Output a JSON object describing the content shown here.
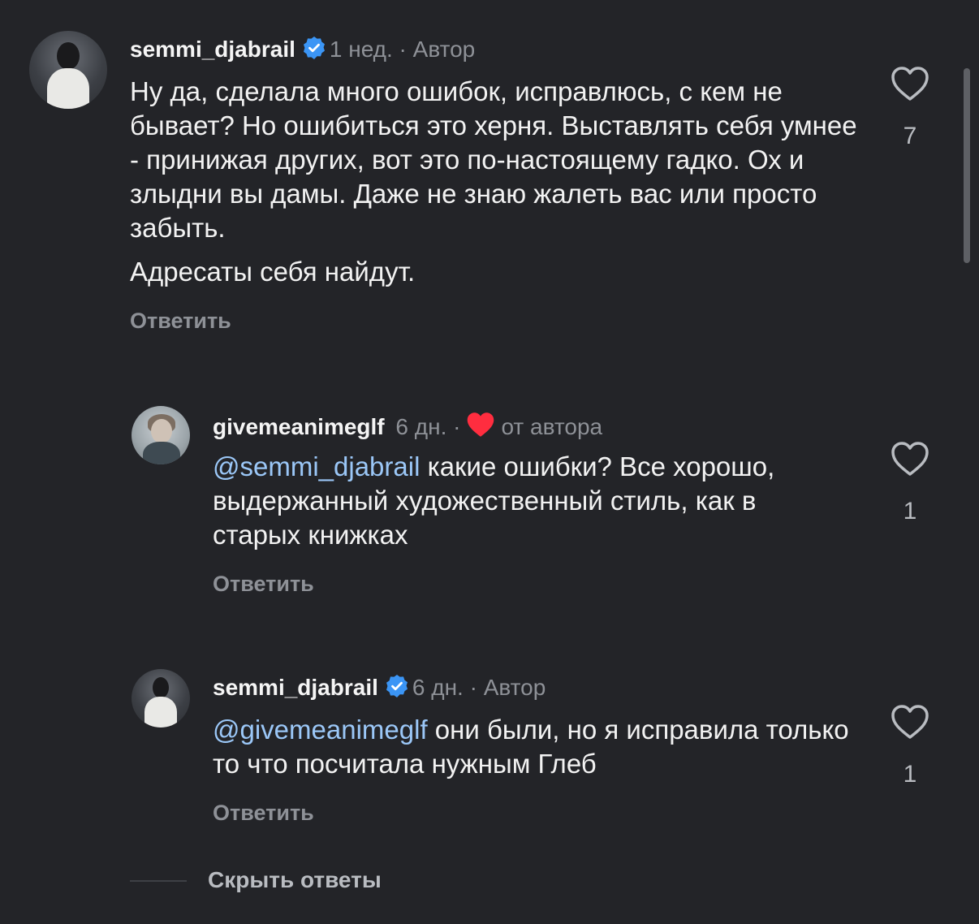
{
  "comments": [
    {
      "username": "semmi_djabrail",
      "verified": true,
      "time": "1 нед.",
      "separator": "·",
      "tag": "Автор",
      "paragraphs": [
        "Ну да, сделала много ошибок, исправлюсь, с кем не бывает? Но ошибиться это херня. Выставлять себя умнее - принижая других, вот это по-настоящему гадко. Ох и злыдни вы дамы. Даже не знаю жалеть вас или просто забыть.",
        "Адресаты себя найдут."
      ],
      "reply_label": "Ответить",
      "likes": "7"
    },
    {
      "username": "givemeanimeglf",
      "verified": false,
      "time": "6 дн.",
      "separator": "·",
      "tag": "от автора",
      "liked_by_author": true,
      "mention": "@semmi_djabrail",
      "text": " какие ошибки? Все хорошо, выдержанный художественный стиль, как в старых книжках",
      "reply_label": "Ответить",
      "likes": "1"
    },
    {
      "username": "semmi_djabrail",
      "verified": true,
      "time": "6 дн.",
      "separator": "·",
      "tag": "Автор",
      "mention": "@givemeanimeglf",
      "text": " они были, но я исправила только то что посчитала нужным Глеб",
      "reply_label": "Ответить",
      "likes": "1"
    }
  ],
  "hide_replies": "Скрыть ответы",
  "colors": {
    "background": "#232428",
    "mention": "#9bc7f7",
    "verified": "#3b95f5",
    "heart_red": "#ff2d3f",
    "muted": "#8e9197"
  },
  "icons": {
    "like": "heart-outline-icon",
    "verified": "verified-badge-icon",
    "author_like": "heart-filled-icon"
  }
}
